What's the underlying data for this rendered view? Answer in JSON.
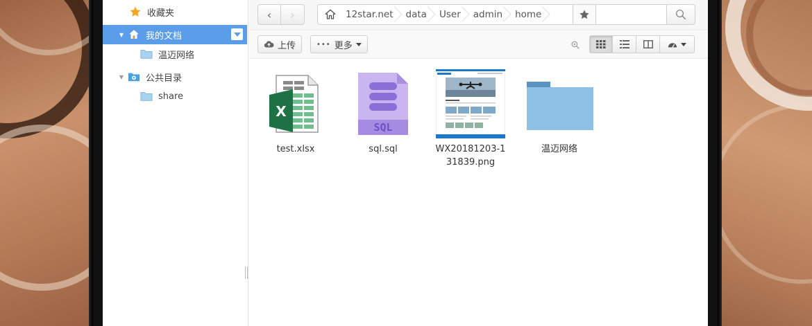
{
  "sidebar": {
    "items": [
      {
        "label": "收藏夹",
        "icon": "star-icon"
      },
      {
        "label": "我的文档",
        "icon": "home-icon",
        "selected": true
      },
      {
        "label": "温迈网络",
        "icon": "folder-icon"
      },
      {
        "label": "公共目录",
        "icon": "public-folder-icon"
      },
      {
        "label": "share",
        "icon": "folder-icon"
      }
    ]
  },
  "address": {
    "crumbs": [
      "12star.net",
      "data",
      "User",
      "admin",
      "home"
    ],
    "search_placeholder": ""
  },
  "toolbar": {
    "upload_label": "上传",
    "more_label": "更多"
  },
  "files": [
    {
      "name": "test.xlsx",
      "icon": "excel-file-icon"
    },
    {
      "name": "sql.sql",
      "icon": "sql-file-icon"
    },
    {
      "name": "WX20181203-131839.png",
      "icon": "image-thumbnail"
    },
    {
      "name": "温迈网络",
      "icon": "folder-icon"
    }
  ],
  "colors": {
    "selection": "#5b9de9",
    "folder": "#8fc0e6",
    "excel_green": "#1e7145",
    "sql_purple": "#8c6fd6"
  }
}
